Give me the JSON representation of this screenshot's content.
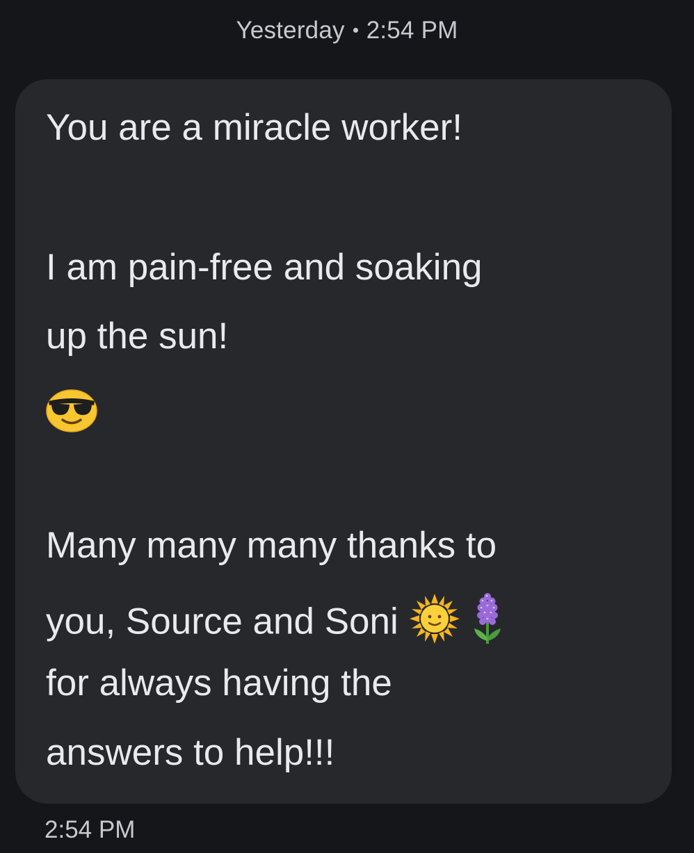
{
  "header": {
    "day_label": "Yesterday",
    "time_label": "2:54 PM"
  },
  "message": {
    "line1": "You are a miracle worker!",
    "line2": "I am pain-free and soaking",
    "line3": "up the sun!",
    "emoji1": "smiling-face-with-sunglasses",
    "line4": "Many many many thanks to",
    "line5": "you, Source and Soni",
    "emoji2": "sun-with-face",
    "emoji3": "hyacinth",
    "line6": "for always having the",
    "line7": "answers to help!!!"
  },
  "footer": {
    "time_label": "2:54 PM"
  },
  "colors": {
    "background": "#151619",
    "bubble": "#27282c",
    "text": "#e9eaee",
    "meta_text": "#c8c9ce"
  }
}
